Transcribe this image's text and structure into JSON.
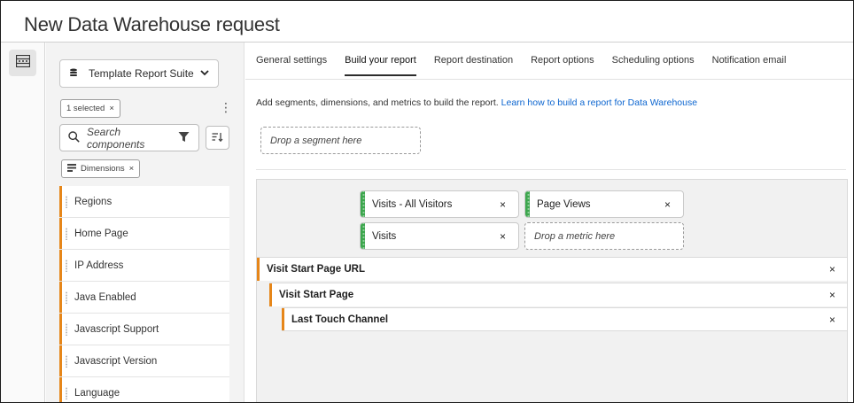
{
  "window": {
    "title": "New Data Warehouse request"
  },
  "rail": {
    "icon": "panel-icon"
  },
  "panel": {
    "report_suite": {
      "label": "Template Report Suite",
      "icon": "stack-icon"
    },
    "selected_tag": {
      "label": "1 selected",
      "remove": "×"
    },
    "search": {
      "placeholder": "Search components"
    },
    "dimensions_tag": {
      "label": "Dimensions",
      "remove": "×"
    },
    "dimensions": [
      "Regions",
      "Home Page",
      "IP Address",
      "Java Enabled",
      "Javascript Support",
      "Javascript Version",
      "Language"
    ]
  },
  "tabs": [
    {
      "label": "General settings",
      "active": false
    },
    {
      "label": "Build your report",
      "active": true
    },
    {
      "label": "Report destination",
      "active": false
    },
    {
      "label": "Report options",
      "active": false
    },
    {
      "label": "Scheduling options",
      "active": false
    },
    {
      "label": "Notification email",
      "active": false
    }
  ],
  "main": {
    "instructions": "Add segments, dimensions, and metrics to build the report.",
    "learn_link": "Learn how to build a report for Data Warehouse",
    "segment_drop": "Drop a segment here",
    "metrics": [
      {
        "label": "Visits - All Visitors",
        "remove": "×"
      },
      {
        "label": "Page Views",
        "remove": "×"
      },
      {
        "label": "Visits",
        "remove": "×"
      }
    ],
    "metric_drop": "Drop a metric here",
    "dimension_rows": [
      {
        "label": "Visit Start Page URL",
        "remove": "×"
      },
      {
        "label": "Visit Start Page",
        "remove": "×"
      },
      {
        "label": "Last Touch Channel",
        "remove": "×"
      }
    ]
  },
  "colors": {
    "dimension_accent": "#e68619",
    "metric_accent": "#3da74e",
    "link": "#0d66d0"
  }
}
